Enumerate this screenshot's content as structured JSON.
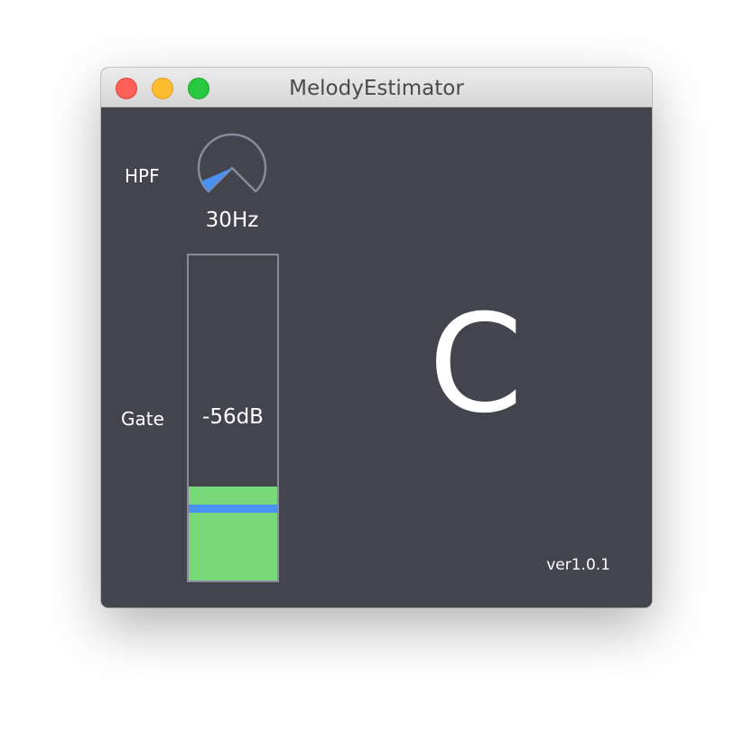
{
  "window": {
    "title": "MelodyEstimator"
  },
  "hpf": {
    "label": "HPF",
    "value": "30Hz",
    "knob_level": 0.04
  },
  "gate": {
    "label": "Gate",
    "value": "-56dB",
    "input_level": 0.29,
    "threshold_level": 0.22
  },
  "display": {
    "note": "C"
  },
  "footer": {
    "version": "ver1.0.1"
  },
  "colors": {
    "background": "#44444f",
    "meter_fill": "#79d879",
    "accent": "#4a90ef",
    "outline": "#8a8a9c"
  }
}
